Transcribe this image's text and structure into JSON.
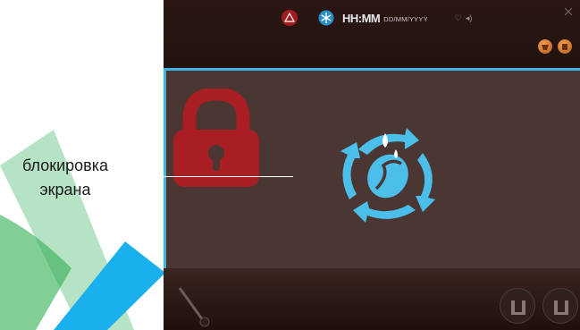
{
  "status_bar": {
    "time": "HH:MM",
    "date": "DD/MM/YYYY",
    "icons": [
      "alert-icon",
      "snowflake-icon",
      "heart-icon",
      "speaker-icon"
    ]
  },
  "annotation": {
    "line1": "блокировка",
    "line2": "экрана"
  },
  "colors": {
    "accent": "#3fb4e0",
    "lock": "#a81e22",
    "panel": "#4a3733"
  },
  "icons": {
    "lock": "padlock-icon",
    "cleaning": "descaling-cycle-icon",
    "top_buttons": [
      "recipe-icon",
      "profile-icon"
    ],
    "bottom_buttons": [
      "cup-icon",
      "cup-icon"
    ]
  }
}
